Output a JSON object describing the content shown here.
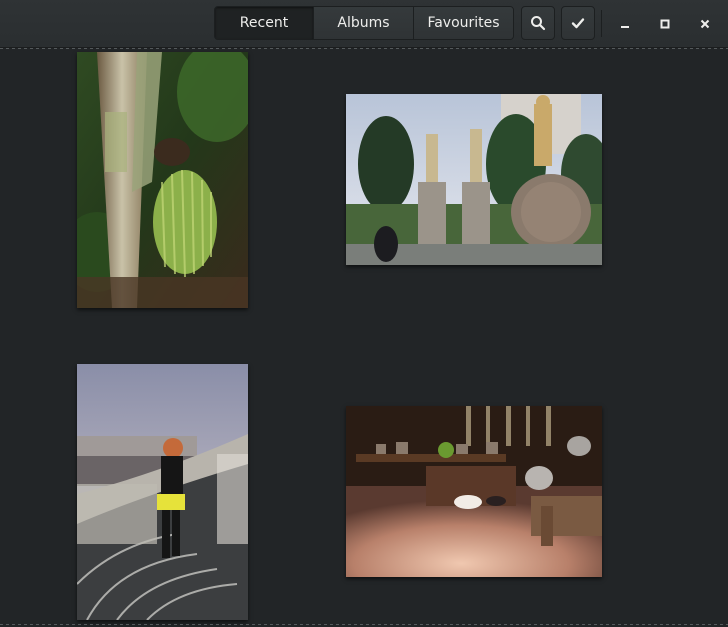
{
  "header": {
    "tabs": [
      {
        "label": "Recent",
        "active": true
      },
      {
        "label": "Albums",
        "active": false
      },
      {
        "label": "Favourites",
        "active": false
      }
    ],
    "search_icon": "search-icon",
    "select_icon": "checkmark-icon",
    "window_controls": [
      "minimize-icon",
      "maximize-icon",
      "close-icon"
    ]
  },
  "colors": {
    "background": "#222527",
    "headerbar": "#2d3133",
    "text": "#eeeeec"
  },
  "photos": [
    {
      "subject": "palm tree with green fruit cluster",
      "orientation": "portrait"
    },
    {
      "subject": "statues in park with dome sculpture",
      "orientation": "landscape"
    },
    {
      "subject": "woman on curved mosaic walkway at dusk",
      "orientation": "portrait"
    },
    {
      "subject": "dim kitchen interior with pots and rabbit",
      "orientation": "landscape"
    }
  ]
}
